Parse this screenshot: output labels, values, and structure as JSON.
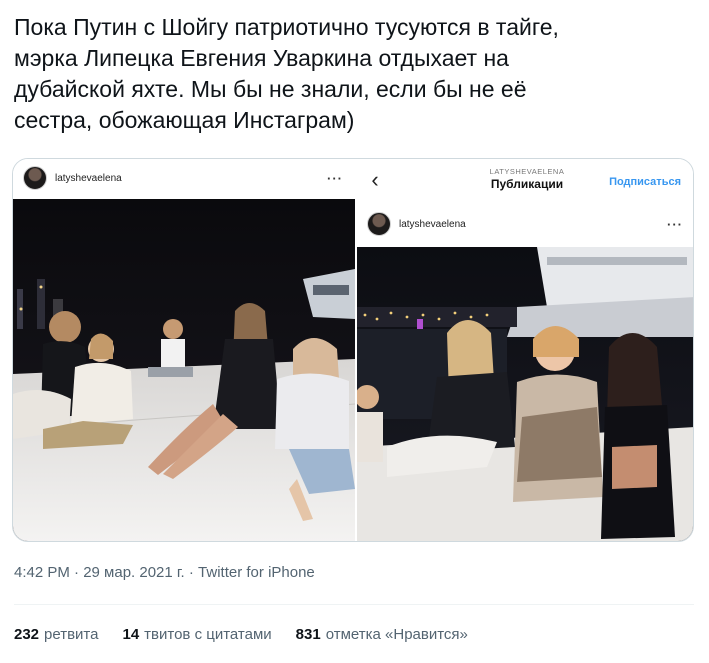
{
  "tweet": {
    "text": "Пока Путин с Шойгу патриотично тусуются в тайге,\nмэрка Липецка Евгения Уваркина отдыхает на\nдубайской яхте. Мы бы не знали, если бы не её\nсестра, обожающая Инстаграм)",
    "timestamp": "4:42 PM · 29 мар. 2021 г. · Twitter for iPhone"
  },
  "left_post": {
    "username": "latyshevaelena",
    "more": "···"
  },
  "right_post": {
    "back": "‹",
    "account": "LATYSHEVAELENA",
    "section": "Публикации",
    "follow": "Подписаться",
    "username": "latyshevaelena",
    "more": "···"
  },
  "stats": {
    "retweets_count": "232",
    "retweets_label": "ретвита",
    "quotes_count": "14",
    "quotes_label": "твитов с цитатами",
    "likes_count": "831",
    "likes_label": "отметка «Нравится»"
  },
  "colors": {
    "text": "#0f1419",
    "secondary": "#536471",
    "link": "#3897f0",
    "border": "#cfd9de"
  }
}
